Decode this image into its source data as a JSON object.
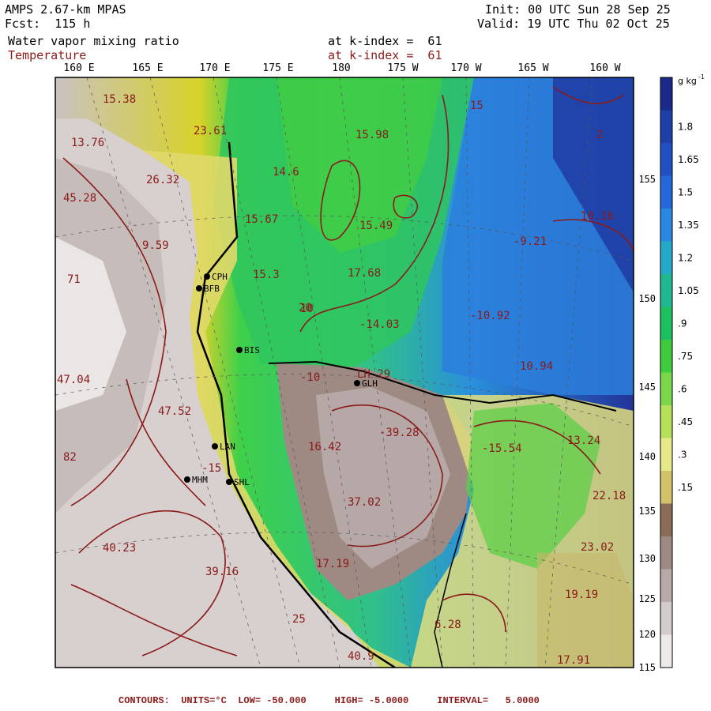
{
  "header": {
    "model": "AMPS 2.67-km MPAS",
    "forecast": "Fcst:  115 h",
    "field1": "Water vapor mixing ratio",
    "field2": "Temperature",
    "k_index_1": "at k-index =  61",
    "k_index_2": "at k-index =  61",
    "init": "Init: 00 UTC Sun 28 Sep 25",
    "valid": "Valid: 19 UTC Thu 02 Oct 25"
  },
  "longitude_labels": [
    "160 E",
    "165 E",
    "170 E",
    "175 E",
    "180",
    "175 W",
    "170 W",
    "165 W",
    "160 W"
  ],
  "latitude_labels": [
    "155",
    "150",
    "145",
    "140",
    "135",
    "130",
    "125",
    "120",
    "115"
  ],
  "colorbar": {
    "unit": "g kg",
    "unit_sup": "-1",
    "labels": [
      "1.8",
      "1.65",
      "1.5",
      "1.35",
      "1.2",
      "1.05",
      ".9",
      ".75",
      ".6",
      ".45",
      ".3",
      ".15"
    ],
    "colors": [
      "#1a2a8a",
      "#1e3fa8",
      "#2050c2",
      "#2468d8",
      "#2a88e0",
      "#26a8c8",
      "#20b890",
      "#1cc060",
      "#3ecc3e",
      "#7ad64a",
      "#b6e05a",
      "#e6e88a",
      "#d2c26a",
      "#8a6b55",
      "#9e8a82",
      "#b8aaa8",
      "#d4cccc",
      "#eeeaea"
    ]
  },
  "stations": [
    "CPH",
    "BFB",
    "BIS",
    "GLH",
    "LAN",
    "MHM",
    "SHL"
  ],
  "contour_labels": [
    "15.38",
    "13.76",
    "23.61",
    "26.32",
    "45.28",
    "9.59",
    "14.6",
    "15.98",
    "15.67",
    "15.49",
    "17.68",
    "-14.03",
    "15.3",
    "10",
    "10.16",
    "-9.21",
    "-10.92",
    "10.94",
    "LH 29",
    "-10",
    "-39.28",
    "47.04",
    "47.52",
    "16.42",
    "37.02",
    "-15.54",
    "13.24",
    "82",
    "-15",
    "40.23",
    "22.18",
    "23.02",
    "39.16",
    "17.19",
    "19.19",
    "6.28",
    "25",
    "40.9",
    "17.91",
    "71",
    "20",
    "2",
    "15"
  ],
  "footer": "CONTOURS:  UNITS=°C  LOW= -50.000     HIGH= -5.0000     INTERVAL=   5.0000"
}
